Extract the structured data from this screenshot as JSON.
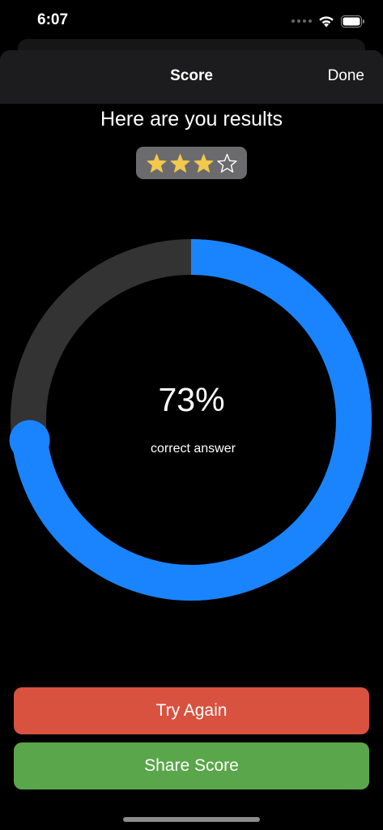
{
  "status_bar": {
    "time": "6:07"
  },
  "nav": {
    "title": "Score",
    "done_label": "Done"
  },
  "headline": "Here are you results",
  "rating": {
    "filled": 3,
    "total": 4,
    "star_color": "#f2c94c"
  },
  "score": {
    "value_text": "73%",
    "fraction": 0.73,
    "caption": "correct answer",
    "progress_color": "#1a84ff",
    "track_color": "#333333"
  },
  "buttons": {
    "try_again": {
      "label": "Try Again",
      "color": "#d9513f"
    },
    "share_score": {
      "label": "Share Score",
      "color": "#5aa64a"
    }
  }
}
